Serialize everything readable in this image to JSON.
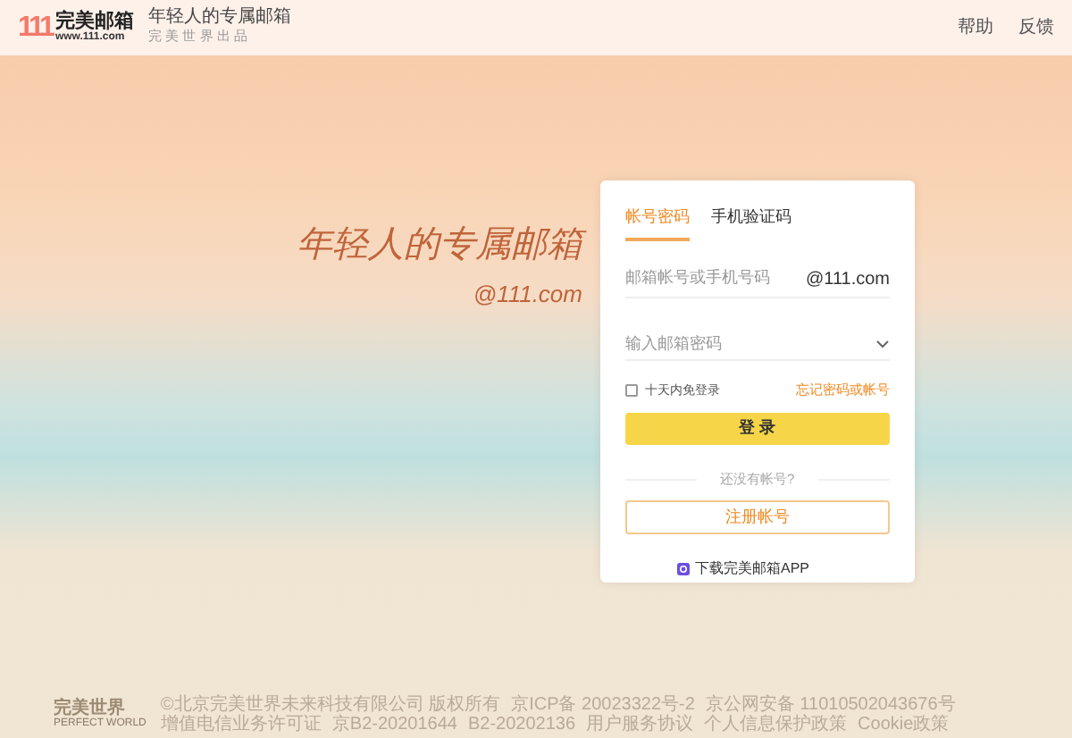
{
  "header": {
    "logo_mark": "111",
    "logo_name": "完美邮箱",
    "logo_url": "www.111.com",
    "slogan": "年轻人的专属邮箱",
    "slogan_sub": "完 美 世 界 出 品",
    "links": [
      "帮助",
      "反馈"
    ]
  },
  "hero": {
    "headline": "年轻人的专属邮箱",
    "domain": "@111.com"
  },
  "login": {
    "tabs": [
      {
        "label": "帐号密码",
        "selected": true
      },
      {
        "label": "手机验证码",
        "selected": false
      }
    ],
    "account_field": {
      "placeholder": "邮箱帐号或手机号码",
      "suffix": "@111.com"
    },
    "password_field": {
      "placeholder": "输入邮箱密码"
    },
    "remember": {
      "label": "十天内免登录",
      "checked": false
    },
    "forgot_link": "忘记密码或帐号",
    "login_button": "登 录",
    "divider_text": "还没有帐号?",
    "register_button": "注册帐号",
    "app_download": "下载完美邮箱APP"
  },
  "footer": {
    "logo": "完美世界",
    "logo_sub": "PERFECT WORLD",
    "items": [
      "©北京完美世界未来科技有限公司 版权所有",
      "京ICP备 20023322号-2",
      "京公网安备 11010502043676号",
      "增值电信业务许可证",
      "京B2-20201644",
      "B2-20202136",
      "用户服务协议",
      "个人信息保护政策",
      "Cookie政策"
    ]
  }
}
